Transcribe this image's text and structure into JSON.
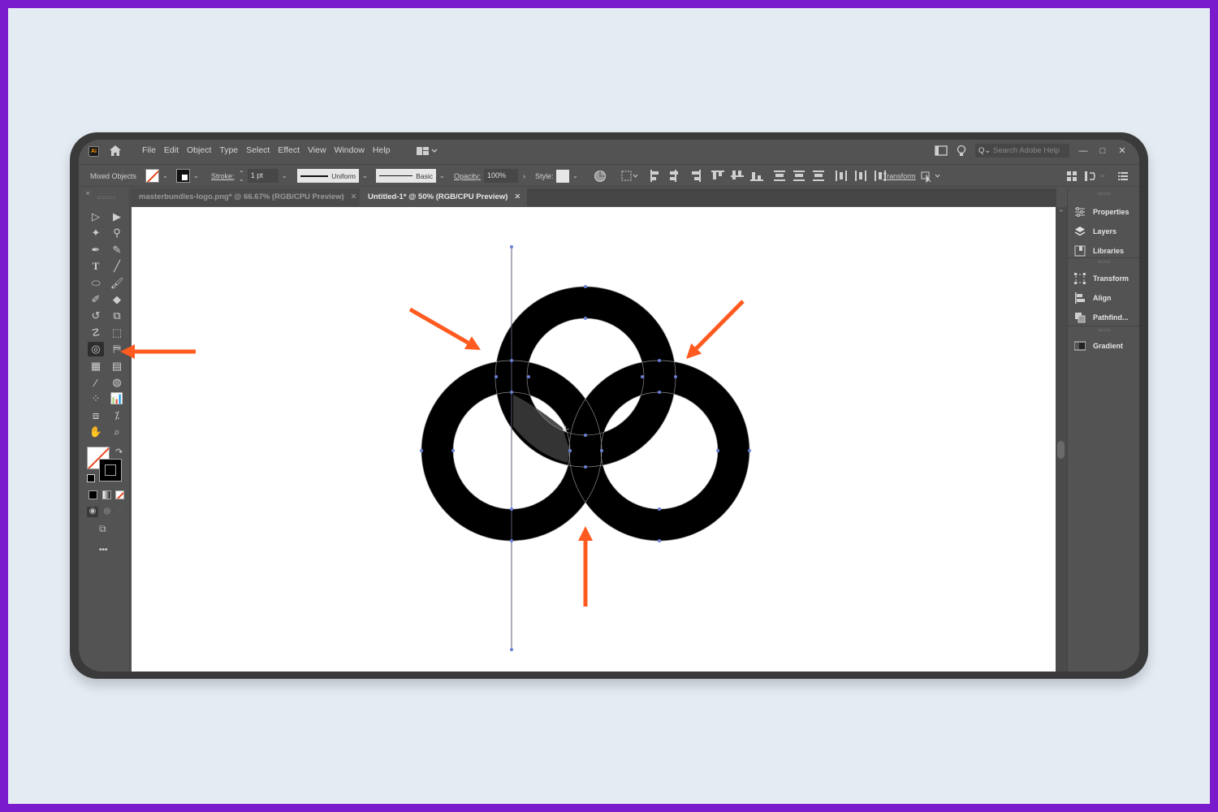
{
  "app": {
    "logo_text": "Ai",
    "menu": [
      "File",
      "Edit",
      "Object",
      "Type",
      "Select",
      "Effect",
      "View",
      "Window",
      "Help"
    ],
    "search_placeholder": "Search Adobe Help",
    "window_controls": {
      "minimize": "—",
      "maximize": "□",
      "close": "✕"
    }
  },
  "controlbar": {
    "selection_label": "Mixed Objects",
    "stroke_label": "Stroke:",
    "stroke_weight": "1 pt",
    "stroke_profile": "Uniform",
    "brush": "Basic",
    "opacity_label": "Opacity:",
    "opacity_value": "100%",
    "style_label": "Style:",
    "transform_label": "Transform"
  },
  "tabs": [
    {
      "label": "masterbundles-logo.png* @ 66.67% (RGB/CPU Preview)",
      "active": false,
      "close": "✕"
    },
    {
      "label": "Untitled-1* @ 50% (RGB/CPU Preview)",
      "active": true,
      "close": "✕"
    }
  ],
  "tools": [
    "direct-selection-tool",
    "selection-tool",
    "magic-wand-tool",
    "lasso-tool",
    "pen-tool",
    "curvature-tool",
    "type-tool",
    "line-segment-tool",
    "ellipse-tool",
    "paintbrush-tool",
    "shaper-tool",
    "eraser-tool",
    "rotate-tool",
    "scale-tool",
    "puppet-warp-tool",
    "free-transform-tool",
    "shape-builder-tool",
    "live-paint-bucket-tool",
    "mesh-tool",
    "gradient-tool",
    "eyedropper-tool",
    "blend-tool",
    "symbol-sprayer-tool",
    "column-graph-tool",
    "artboard-tool",
    "slice-tool",
    "hand-tool",
    "zoom-tool"
  ],
  "selected_tool": "shape-builder-tool",
  "more_tools_label": "•••",
  "right_panel": {
    "group1": [
      "Properties",
      "Layers",
      "Libraries"
    ],
    "group2": [
      "Transform",
      "Align",
      "Pathfind..."
    ],
    "group3": [
      "Gradient"
    ]
  },
  "annotations": {
    "arrow_color": "#ff5a1f",
    "arrows": [
      "points-to-shape-builder-tool",
      "points-to-top-left-intersection",
      "points-to-top-right-intersection",
      "points-to-bottom-intersection"
    ]
  },
  "artwork": {
    "description": "Three interlocking black rings with a vertical guide line",
    "ring_color": "#000000",
    "anchor_color": "#6b7fd6"
  },
  "colors": {
    "frame_border": "#7a1ccc",
    "page_bg": "#e4ebf3",
    "ui_bg": "#535353",
    "accent": "#ff5a1f"
  }
}
